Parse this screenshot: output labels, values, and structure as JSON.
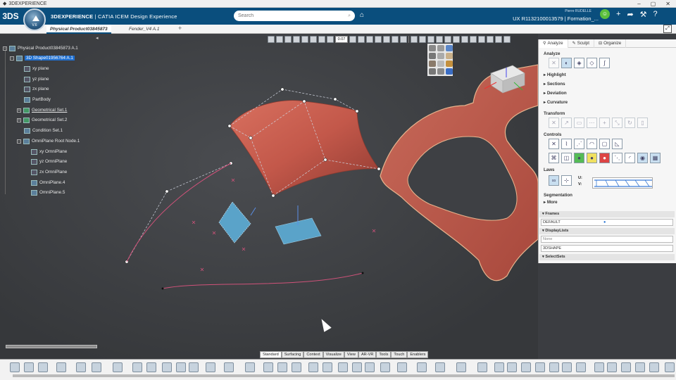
{
  "titlebar": {
    "title": "3DEXPERIENCE"
  },
  "app": {
    "brand_3d": "3DEXPERIENCE",
    "brand_rest": " | CATIA ICEM Design Experience",
    "compass_version": "V.6"
  },
  "search": {
    "placeholder": "Search"
  },
  "user": {
    "name": "Pierre RUDELLE",
    "role": "UX R1132100013579 | Formation_..."
  },
  "tabs": {
    "active": "Physical Product03845873",
    "second": "Fender_V4 A.1",
    "add": "+"
  },
  "tree": {
    "root": "Physical Product03845873 A.1",
    "shape": "3D Shape01956764 A.1",
    "xy": "xy plane",
    "yz": "yz plane",
    "zx": "zx plane",
    "partbody": "PartBody",
    "geo1": "Geometrical Set.1",
    "geo2": "Geometrical Set.2",
    "cond": "Condition Set.1",
    "omni": "OmniPlane Root Node.1",
    "oxy": "xy OmniPlane",
    "oyz": "yz OmniPlane",
    "ozx": "zx OmniPlane",
    "op4": "OmniPlane.4",
    "op5": "OmniPlane.5"
  },
  "viewtoolbar": {
    "zoom": "0.07"
  },
  "rpanel": {
    "tabs": [
      "Analyze",
      "Sculpt",
      "Organize"
    ],
    "analyze": "Analyze",
    "highlight": "Highlight",
    "sections": "Sections",
    "deviation": "Deviation",
    "curvature": "Curvature",
    "transform": "Transform",
    "controls": "Controls",
    "laws": "Laws",
    "law_u": "U:",
    "law_v": "V:",
    "segmentation": "Segmentation",
    "more": "More",
    "frames": "Frames",
    "frames_default": "DEFAULT",
    "displaylists": "DisplayLists",
    "dl_none": "None",
    "dl_shape": "3DSHAPE",
    "selectsets": "SelectSets"
  },
  "bottom_tabs": [
    "Standard",
    "Surfacing",
    "Context",
    "Visualize",
    "View",
    "AR-VR",
    "Tools",
    "Touch",
    "Enablers"
  ],
  "colors": {
    "surface": "#c3584a",
    "curve": "#d0527a",
    "plane": "#5aa3c9",
    "appbar": "#0a4e7d"
  }
}
